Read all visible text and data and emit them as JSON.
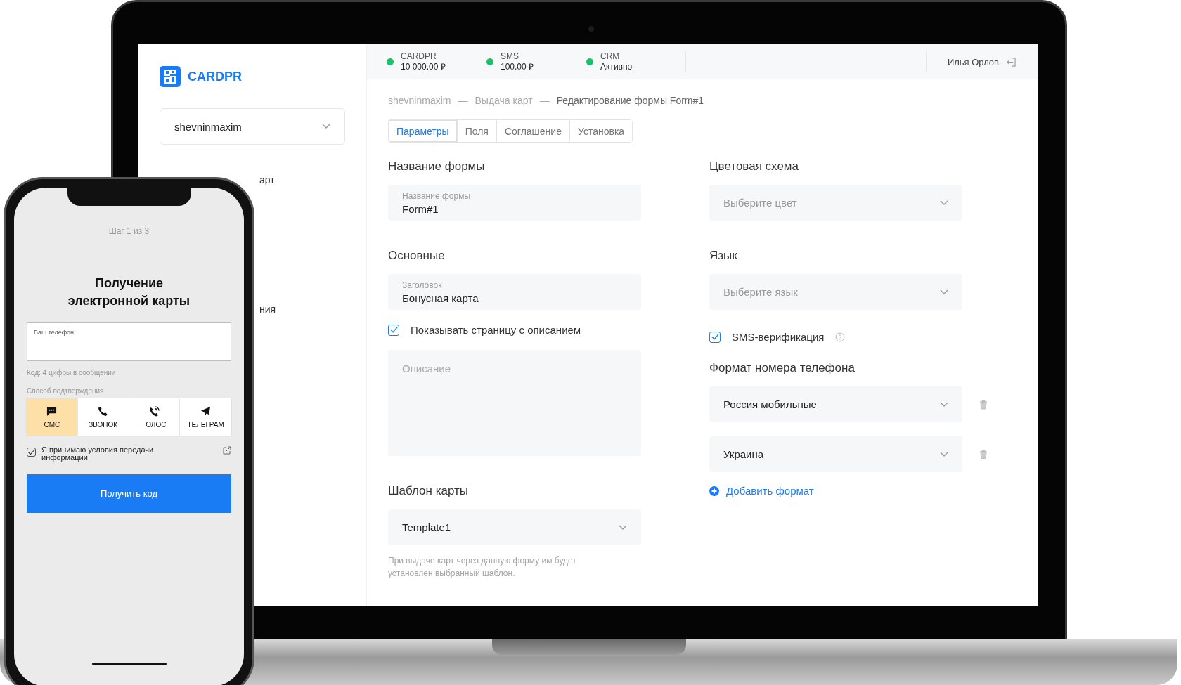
{
  "app": {
    "logo": "CARDPR",
    "account": "shevninmaxim",
    "sidebar_items": [
      "арт",
      "ния"
    ]
  },
  "top_bar": {
    "stats": [
      {
        "label": "CARDPR",
        "value": "10 000.00 ₽",
        "active": true
      },
      {
        "label": "SMS",
        "value": "100.00 ₽",
        "active": true
      },
      {
        "label": "CRM",
        "value": "Активно",
        "active": true
      }
    ],
    "user": "Илья Орлов"
  },
  "breadcrumb_separator": "—",
  "breadcrumb": [
    "shevninmaxim",
    "Выдача карт",
    "Редактирование формы Form#1"
  ],
  "tabs": [
    {
      "label": "Параметры",
      "selected": true
    },
    {
      "label": "Поля",
      "selected": false
    },
    {
      "label": "Соглашение",
      "selected": false
    },
    {
      "label": "Установка",
      "selected": false
    }
  ],
  "left": {
    "name_heading": "Название формы",
    "name_field": {
      "label": "Название формы",
      "value": "Form#1"
    },
    "main_heading": "Основные",
    "title_field": {
      "label": "Заголовок",
      "value": "Бонусная карта"
    },
    "show_description": {
      "label": "Показывать страницу с описанием",
      "checked": true
    },
    "description": {
      "placeholder": "Описание"
    },
    "template_heading": "Шаблон карты",
    "template": "Template1",
    "template_hint": "При выдаче карт через данную форму им будет установлен выбранный шаблон."
  },
  "right": {
    "color_heading": "Цветовая схема",
    "color_select": {
      "placeholder": "Выберите цвет"
    },
    "language_heading": "Язык",
    "language_select": {
      "placeholder": "Выберите язык"
    },
    "sms_verification": {
      "label": "SMS-верификация",
      "checked": true
    },
    "phone_format_heading": "Формат номера телефона",
    "phone_formats": [
      "Россия мобильные",
      "Украина"
    ],
    "add_format": "Добавить формат"
  },
  "phone": {
    "step": "Шаг 1 из 3",
    "title": "Получение электронной карты",
    "phone_field": {
      "label": "Ваш телефон"
    },
    "code_hint": "Код: 4 цифры в сообщении",
    "method_label": "Способ подтверждения",
    "methods": [
      {
        "label": "СМС",
        "kind": "sms",
        "selected": true
      },
      {
        "label": "ЗВОНОК",
        "kind": "call",
        "selected": false
      },
      {
        "label": "ГОЛОС",
        "kind": "voice",
        "selected": false
      },
      {
        "label": "ТЕЛЕГРАМ",
        "kind": "telegram",
        "selected": false
      }
    ],
    "consent": {
      "label": "Я принимаю условия передачи информации",
      "checked": true
    },
    "button": "Получить код"
  }
}
